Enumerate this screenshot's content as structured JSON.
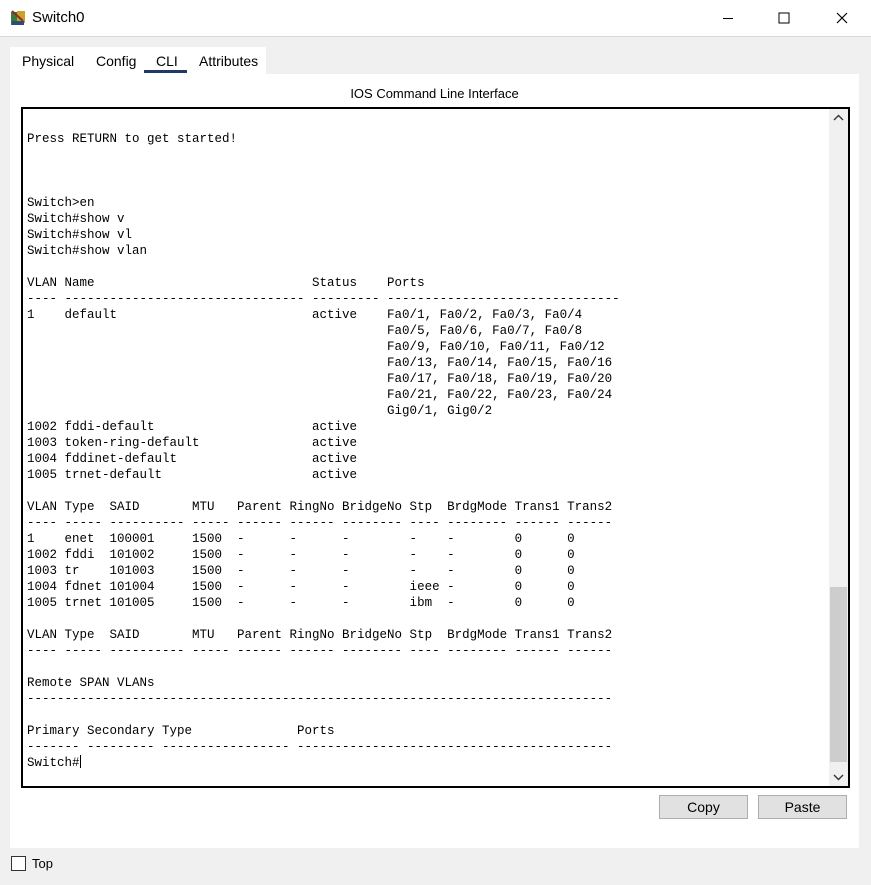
{
  "window": {
    "title": "Switch0",
    "icon": "switch-device-icon"
  },
  "tabs": [
    {
      "label": "Physical",
      "active": false
    },
    {
      "label": "Config",
      "active": false
    },
    {
      "label": "CLI",
      "active": true
    },
    {
      "label": "Attributes",
      "active": false
    }
  ],
  "cli": {
    "heading": "IOS Command Line Interface",
    "output": "\nPress RETURN to get started!\n\n\n\nSwitch>en\nSwitch#show v\nSwitch#show vl\nSwitch#show vlan\n\nVLAN Name                             Status    Ports\n---- -------------------------------- --------- -------------------------------\n1    default                          active    Fa0/1, Fa0/2, Fa0/3, Fa0/4\n                                                Fa0/5, Fa0/6, Fa0/7, Fa0/8\n                                                Fa0/9, Fa0/10, Fa0/11, Fa0/12\n                                                Fa0/13, Fa0/14, Fa0/15, Fa0/16\n                                                Fa0/17, Fa0/18, Fa0/19, Fa0/20\n                                                Fa0/21, Fa0/22, Fa0/23, Fa0/24\n                                                Gig0/1, Gig0/2\n1002 fddi-default                     active\n1003 token-ring-default               active\n1004 fddinet-default                  active\n1005 trnet-default                    active\n\nVLAN Type  SAID       MTU   Parent RingNo BridgeNo Stp  BrdgMode Trans1 Trans2\n---- ----- ---------- ----- ------ ------ -------- ---- -------- ------ ------\n1    enet  100001     1500  -      -      -        -    -        0      0\n1002 fddi  101002     1500  -      -      -        -    -        0      0\n1003 tr    101003     1500  -      -      -        -    -        0      0\n1004 fdnet 101004     1500  -      -      -        ieee -        0      0\n1005 trnet 101005     1500  -      -      -        ibm  -        0      0\n\nVLAN Type  SAID       MTU   Parent RingNo BridgeNo Stp  BrdgMode Trans1 Trans2\n---- ----- ---------- ----- ------ ------ -------- ---- -------- ------ ------\n\nRemote SPAN VLANs\n------------------------------------------------------------------------------\n\nPrimary Secondary Type              Ports\n------- --------- ----------------- ------------------------------------------",
    "prompt": "Switch#"
  },
  "buttons": {
    "copy": "Copy",
    "paste": "Paste"
  },
  "footer": {
    "top_label": "Top",
    "top_checked": false
  }
}
